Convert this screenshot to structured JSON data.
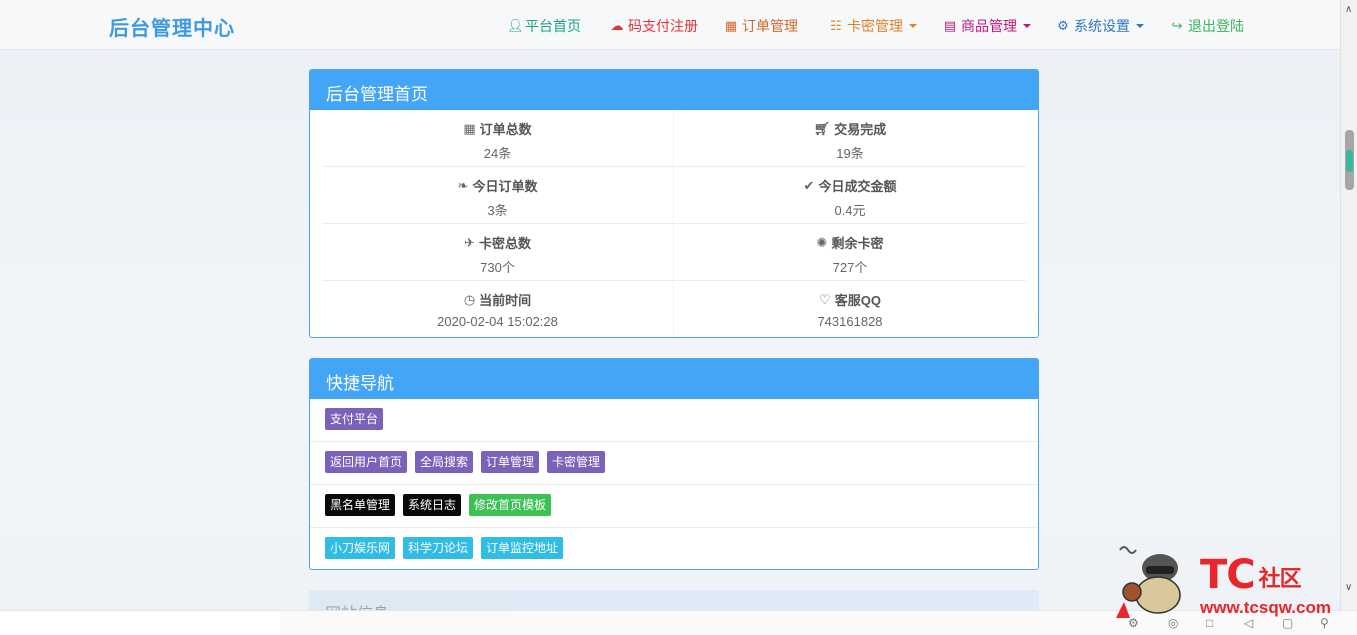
{
  "nav": {
    "brand": "后台管理中心",
    "items": [
      {
        "label": "平台首页",
        "color": "#1aa18a",
        "icon": "user-icon",
        "dropdown": false
      },
      {
        "label": "码支付注册",
        "color": "#e0343b",
        "icon": "cloud-icon",
        "dropdown": false
      },
      {
        "label": "订单管理",
        "color": "#d06a2e",
        "icon": "calendar-icon",
        "dropdown": false
      },
      {
        "label": "卡密管理",
        "color": "#e0812a",
        "icon": "list-icon",
        "dropdown": true
      },
      {
        "label": "商品管理",
        "color": "#c2187a",
        "icon": "book-icon",
        "dropdown": true
      },
      {
        "label": "系统设置",
        "color": "#2f78c4",
        "icon": "gear-icon",
        "dropdown": true
      },
      {
        "label": "退出登陆",
        "color": "#3cb55c",
        "icon": "logout-icon",
        "dropdown": false
      }
    ]
  },
  "dashboard": {
    "title": "后台管理首页",
    "stats": [
      {
        "label": "订单总数",
        "value": "24条",
        "icon": "grid-icon"
      },
      {
        "label": "交易完成",
        "value": "19条",
        "icon": "cart-icon"
      },
      {
        "label": "今日订单数",
        "value": "3条",
        "icon": "leaf-icon"
      },
      {
        "label": "今日成交金额",
        "value": "0.4元",
        "icon": "check-icon"
      },
      {
        "label": "卡密总数",
        "value": "730个",
        "icon": "plane-icon"
      },
      {
        "label": "剩余卡密",
        "value": "727个",
        "icon": "asterisk-icon"
      },
      {
        "label": "当前时间",
        "value": "2020-02-04 15:02:28",
        "icon": "clock-icon"
      },
      {
        "label": "客服QQ",
        "value": "743161828",
        "icon": "heart-icon"
      }
    ]
  },
  "quicknav": {
    "title": "快捷导航",
    "rows": [
      [
        {
          "label": "支付平台",
          "style": "purple"
        }
      ],
      [
        {
          "label": "返回用户首页",
          "style": "purple"
        },
        {
          "label": "全局搜索",
          "style": "purple"
        },
        {
          "label": "订单管理",
          "style": "purple"
        },
        {
          "label": "卡密管理",
          "style": "purple"
        }
      ],
      [
        {
          "label": "黑名单管理",
          "style": "black"
        },
        {
          "label": "系统日志",
          "style": "black"
        },
        {
          "label": "修改首页模板",
          "style": "green"
        }
      ],
      [
        {
          "label": "小刀娱乐网",
          "style": "cyan"
        },
        {
          "label": "科学刀论坛",
          "style": "cyan"
        },
        {
          "label": "订单监控地址",
          "style": "cyan"
        }
      ]
    ]
  },
  "siteinfo": {
    "title": "网站信息"
  },
  "watermark": {
    "logo": "TC",
    "logo_cn": "社区",
    "url": "www.tcsqw.com"
  }
}
